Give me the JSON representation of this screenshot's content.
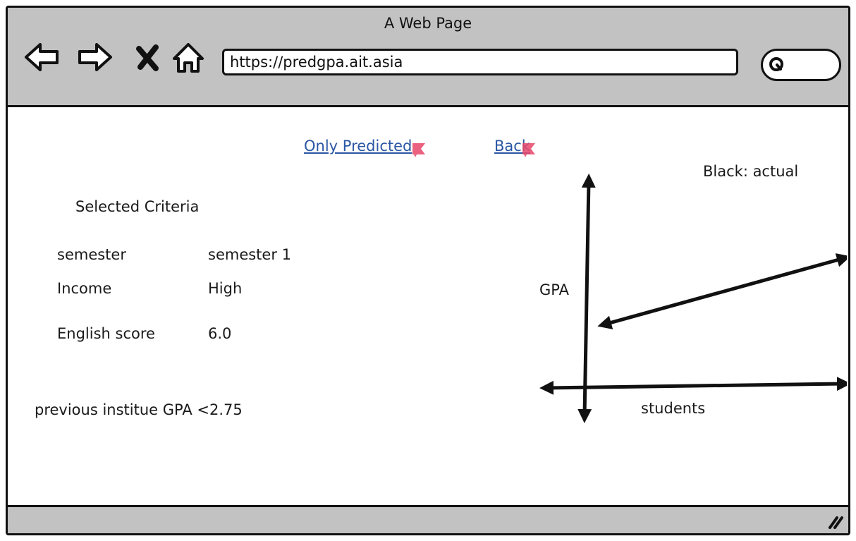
{
  "window": {
    "title": "A Web Page"
  },
  "toolbar": {
    "back_icon": "arrow-left-icon",
    "forward_icon": "arrow-right-icon",
    "stop_icon": "close-icon",
    "home_icon": "home-icon",
    "url": "https://predgpa.ait.asia",
    "search_icon": "search-icon"
  },
  "nav": {
    "only_predicted_label": "Only Predicted",
    "back_label": "Back"
  },
  "criteria": {
    "heading": "Selected Criteria",
    "rows": [
      {
        "label": "semester",
        "value": "semester 1"
      },
      {
        "label": "Income",
        "value": "High"
      },
      {
        "label": "English score",
        "value": "6.0"
      }
    ],
    "note": "previous institue GPA <2.75"
  },
  "chart_data": {
    "type": "line",
    "legend_text": "Black: actual",
    "ylabel": "GPA",
    "xlabel": "students",
    "series": [
      {
        "color": "#111111",
        "values": []
      }
    ]
  },
  "colors": {
    "toolbar_bg": "#c2c2c2",
    "link": "#2b57a4",
    "link_marker": "#e8476a"
  }
}
